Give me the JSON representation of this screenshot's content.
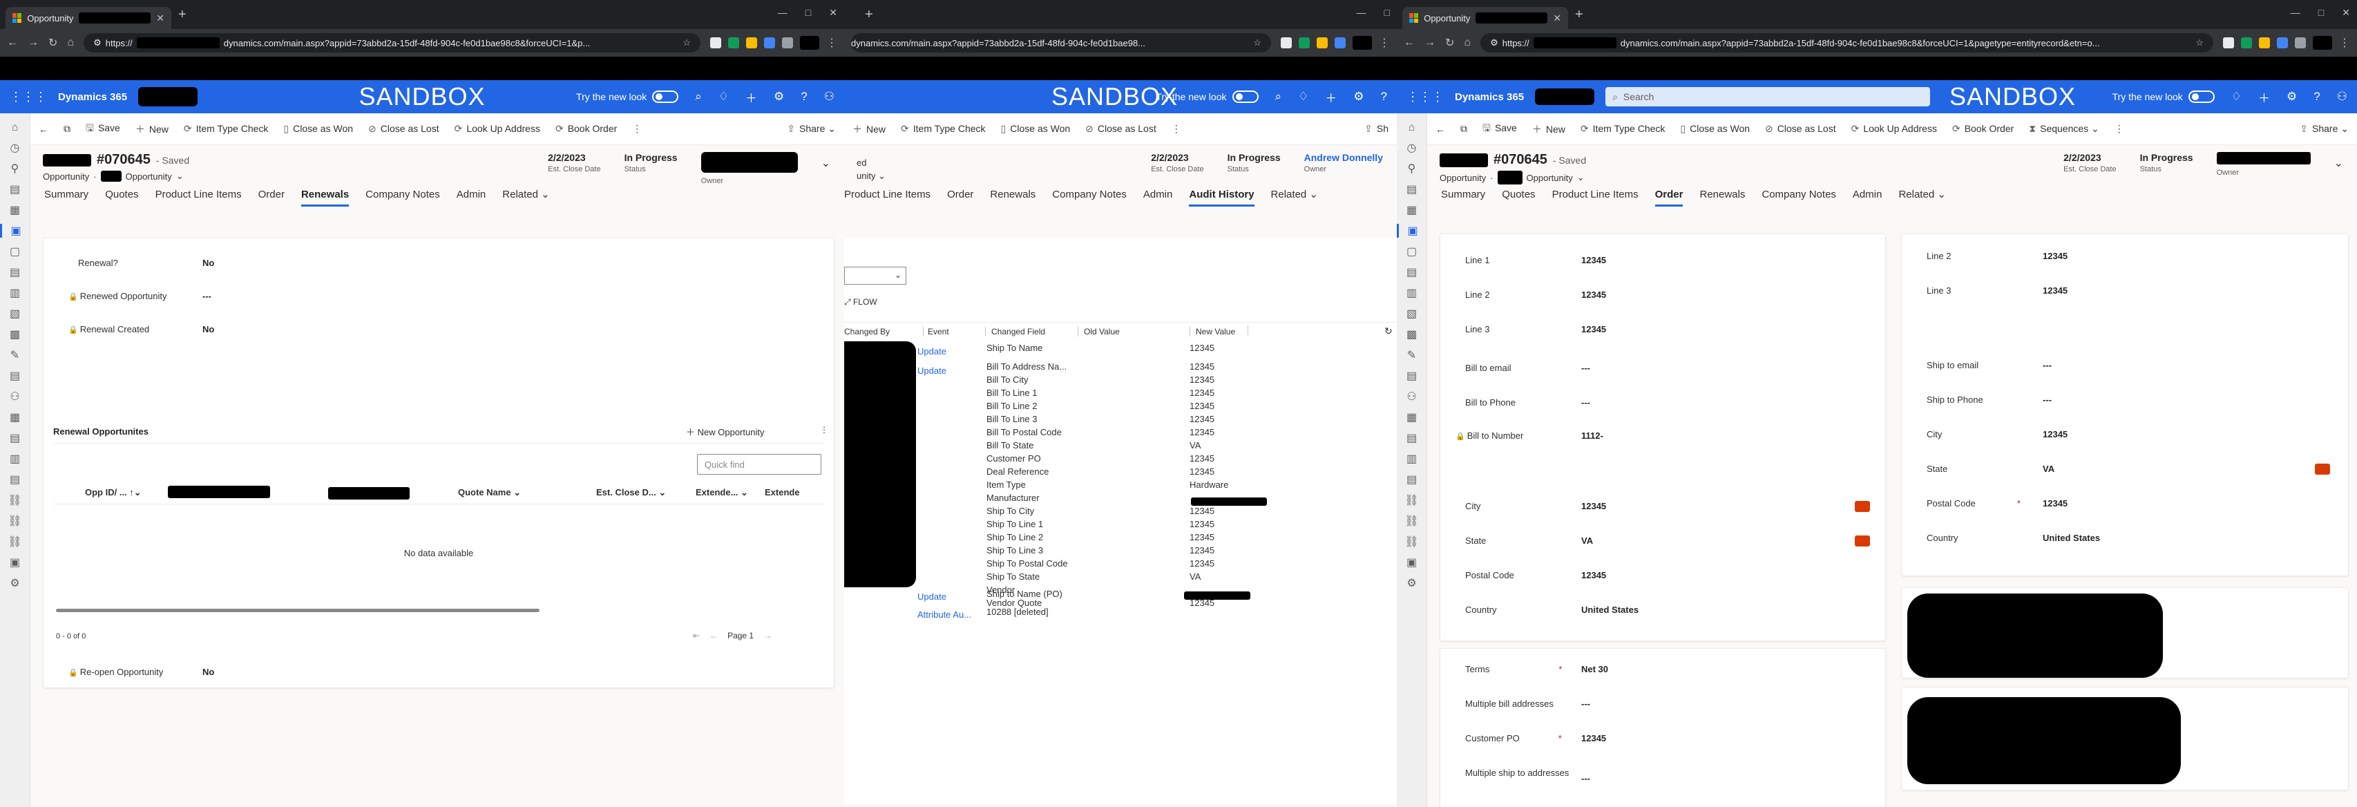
{
  "browser": {
    "tab_title": "Opportunity",
    "new_tab": "+",
    "window_controls": [
      "—",
      "□",
      "✕"
    ],
    "url_w1": "https://",
    "url_w1_rest": "dynamics.com/main.aspx?appid=73abbd2a-15df-48fd-904c-fe0d1bae98c8&forceUCI=1&p...",
    "url_w2": "dynamics.com/main.aspx?appid=73abbd2a-15df-48fd-904c-fe0d1bae98...",
    "url_w3": "https://",
    "url_w3_rest": "dynamics.com/main.aspx?appid=73abbd2a-15df-48fd-904c-fe0d1bae98c8&forceUCI=1&pagetype=entityrecord&etn=o..."
  },
  "app": {
    "name": "Dynamics 365",
    "env_banner": "SANDBOX",
    "try_new_look": "Try the new look",
    "search_placeholder": "Search"
  },
  "commands": {
    "save": "Save",
    "new": "New",
    "item_type_check": "Item Type Check",
    "close_as_won": "Close as Won",
    "close_as_lost": "Close as Lost",
    "look_up_address": "Look Up Address",
    "book_order": "Book Order",
    "sequences": "Sequences",
    "share": "Share",
    "share_short": "Sh"
  },
  "record": {
    "number": "#070645",
    "saved": "- Saved",
    "entity": "Opportunity",
    "form": "Opportunity",
    "close_date": "2/2/2023",
    "close_date_label": "Est. Close Date",
    "status": "In Progress",
    "status_label": "Status",
    "owner_label": "Owner",
    "owner_name": "Andrew Donnelly"
  },
  "tabs": {
    "summary": "Summary",
    "quotes": "Quotes",
    "product_line_items": "Product Line Items",
    "order": "Order",
    "renewals": "Renewals",
    "company_notes": "Company Notes",
    "admin": "Admin",
    "audit_history": "Audit History",
    "related": "Related"
  },
  "renewals": {
    "renewal_label": "Renewal?",
    "renewal_value": "No",
    "renewed_opp_label": "Renewed Opportunity",
    "renewed_opp_value": "---",
    "renewal_created_label": "Renewal Created",
    "renewal_created_value": "No",
    "grid_title": "Renewal Opportunites",
    "new_opportunity": "New Opportunity",
    "quick_find": "Quick find",
    "col_opp_id": "Opp ID/ ...",
    "col_quote_name": "Quote Name",
    "col_est_close": "Est. Close D...",
    "col_extended": "Extende...",
    "col_extende": "Extende",
    "empty": "No data available",
    "count": "0 - 0 of 0",
    "page": "Page 1",
    "reopen_label": "Re-open Opportunity",
    "reopen_value": "No"
  },
  "audit": {
    "flow": "FLOW",
    "col_changed_by": "Changed By",
    "col_event": "Event",
    "col_changed_field": "Changed Field",
    "col_old_value": "Old Value",
    "col_new_value": "New Value",
    "events": [
      "Update",
      "Update",
      "Update",
      "Attribute Au..."
    ],
    "fields_a": [
      "Ship To Name"
    ],
    "values_a": [
      "12345"
    ],
    "fields_b": [
      "Bill To Address Na...",
      "Bill To City",
      "Bill To Line 1",
      "Bill To Line 2",
      "Bill To Line 3",
      "Bill To Postal Code",
      "Bill To State",
      "Customer PO",
      "Deal Reference",
      "Item Type",
      "Manufacturer",
      "Ship To City",
      "Ship To Line 1",
      "Ship To Line 2",
      "Ship To Line 3",
      "Ship To Postal Code",
      "Ship To State",
      "Vendor",
      "Vendor Quote"
    ],
    "values_b": [
      "12345",
      "12345",
      "12345",
      "12345",
      "12345",
      "12345",
      "VA",
      "12345",
      "12345",
      "Hardware",
      "",
      "12345",
      "12345",
      "12345",
      "12345",
      "12345",
      "VA",
      "",
      "12345"
    ],
    "field_c": "Ship to Name (PO)",
    "field_d": "10288 [deleted]"
  },
  "order": {
    "line1_label": "Line 1",
    "line1": "12345",
    "line2_label": "Line 2",
    "line2": "12345",
    "line3_label": "Line 3",
    "line3": "12345",
    "bill_email_label": "Bill to email",
    "bill_email": "---",
    "bill_phone_label": "Bill to Phone",
    "bill_phone": "---",
    "bill_number_label": "Bill to Number",
    "bill_number": "1112-",
    "city_label": "City",
    "city": "12345",
    "state_label": "State",
    "state": "VA",
    "postal_label": "Postal Code",
    "postal": "12345",
    "country_label": "Country",
    "country": "United States",
    "ship_line2_label": "Line 2",
    "ship_line2": "12345",
    "ship_line3_label": "Line 3",
    "ship_line3": "12345",
    "ship_email_label": "Ship to email",
    "ship_email": "---",
    "ship_phone_label": "Ship to Phone",
    "ship_phone": "---",
    "ship_city_label": "City",
    "ship_city": "12345",
    "ship_state_label": "State",
    "ship_state": "VA",
    "ship_postal_label": "Postal Code",
    "ship_postal": "12345",
    "ship_country_label": "Country",
    "ship_country": "United States",
    "terms_label": "Terms",
    "terms": "Net 30",
    "multi_bill_label": "Multiple bill addresses",
    "multi_bill": "---",
    "customer_po_label": "Customer PO",
    "customer_po": "12345",
    "multi_ship_label": "Multiple ship to addresses",
    "multi_ship": "---",
    "required_mark": "*"
  }
}
